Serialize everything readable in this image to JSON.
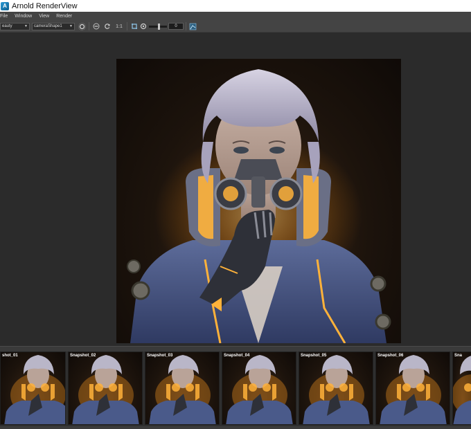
{
  "window": {
    "title": "Arnold RenderView"
  },
  "menu": {
    "items": [
      "File",
      "Window",
      "View",
      "Render"
    ]
  },
  "toolbar": {
    "aov_value": "eauty",
    "camera_value": "cameraShape1",
    "ratio_label": "1:1",
    "exposure_value": "0"
  },
  "render": {
    "subject": "character portrait render"
  },
  "snapshots": [
    "shot_01",
    "Snapshot_02",
    "Snapshot_03",
    "Snapshot_04",
    "Snapshot_05",
    "Snapshot_06",
    "Sna"
  ],
  "colors": {
    "accent_glow": "#ffb23a",
    "jacket": "#4a5a8a",
    "hair": "#b9b6c8",
    "background": "#2b2b2b"
  }
}
